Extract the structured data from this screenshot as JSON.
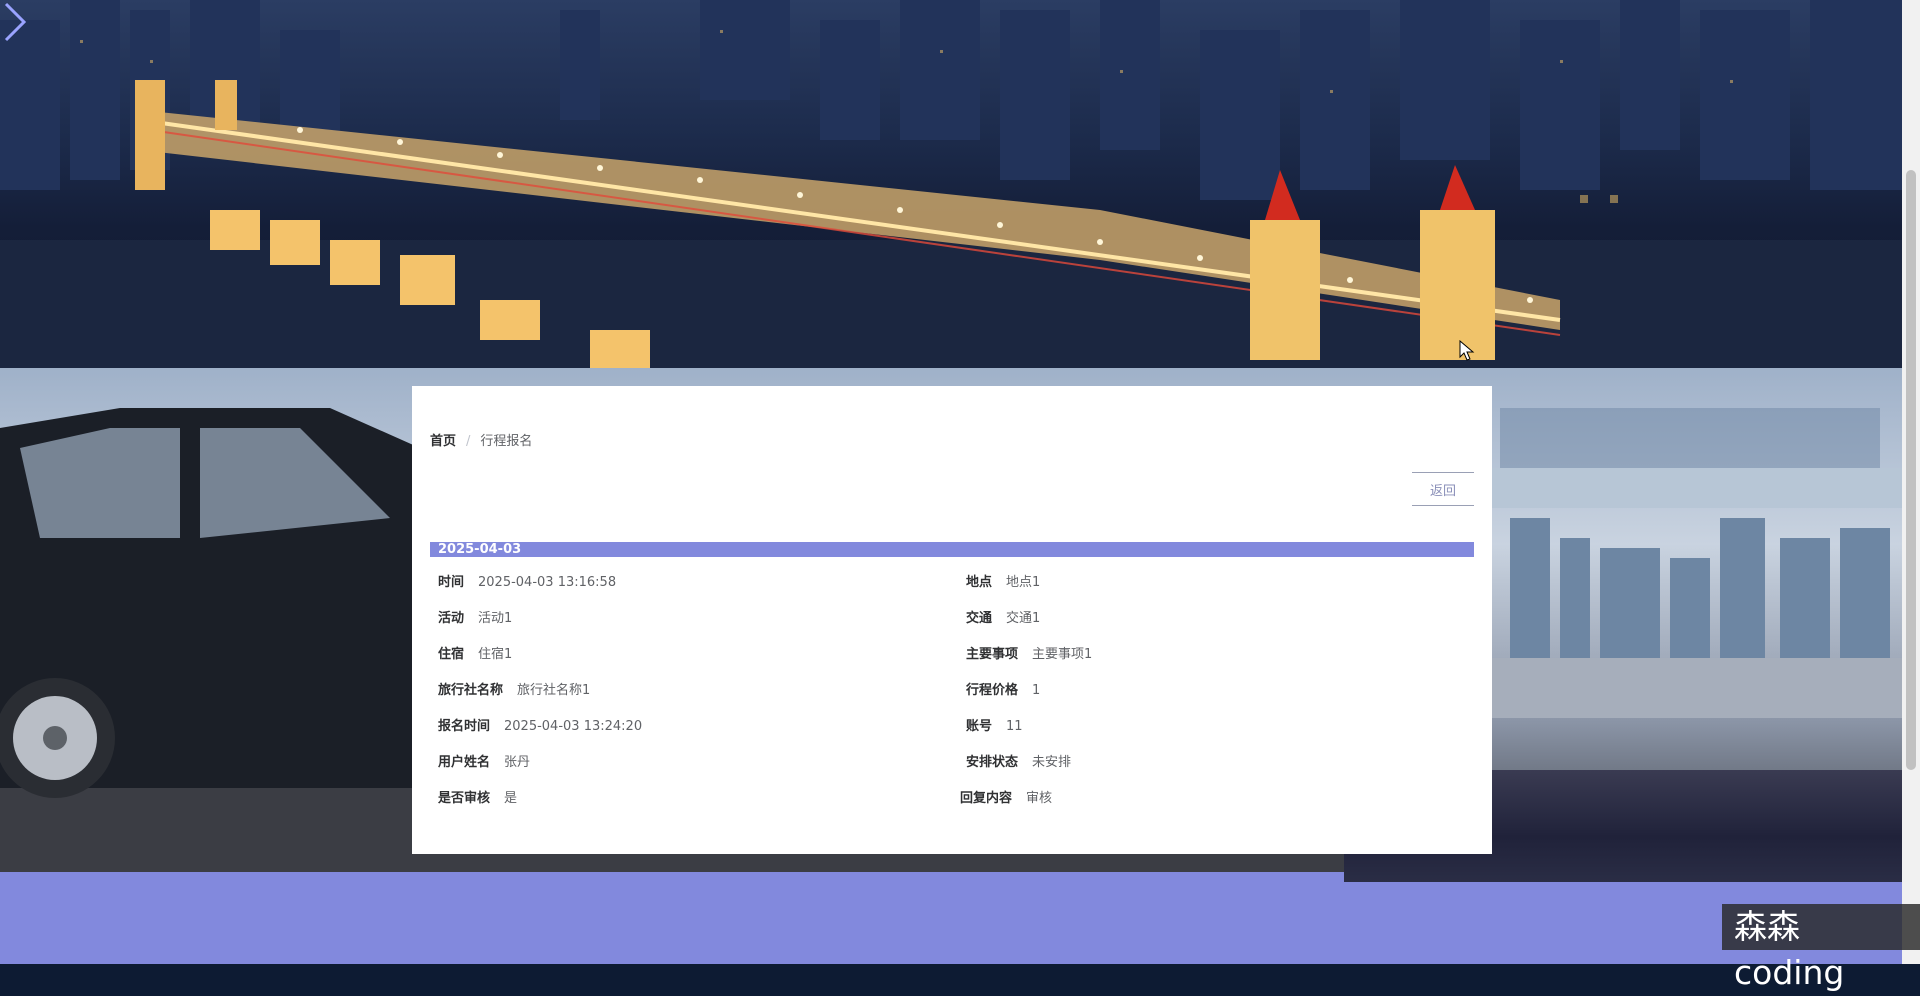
{
  "breadcrumb": {
    "home": "首页",
    "current": "行程报名"
  },
  "actions": {
    "back_label": "返回"
  },
  "record": {
    "date_header": "2025-04-03",
    "left": [
      {
        "label": "时间",
        "value": "2025-04-03 13:16:58"
      },
      {
        "label": "活动",
        "value": "活动1"
      },
      {
        "label": "住宿",
        "value": "住宿1"
      },
      {
        "label": "旅行社名称",
        "value": "旅行社名称1"
      },
      {
        "label": "报名时间",
        "value": "2025-04-03 13:24:20"
      },
      {
        "label": "用户姓名",
        "value": "张丹"
      },
      {
        "label": "是否审核",
        "value": "是"
      }
    ],
    "right": [
      {
        "label": "地点",
        "value": "地点1"
      },
      {
        "label": "交通",
        "value": "交通1"
      },
      {
        "label": "主要事项",
        "value": "主要事项1"
      },
      {
        "label": "行程价格",
        "value": "1"
      },
      {
        "label": "账号",
        "value": "11"
      },
      {
        "label": "安排状态",
        "value": "未安排"
      },
      {
        "label": "回复内容",
        "value": "审核"
      }
    ]
  },
  "watermark": "森森coding",
  "icons": {
    "banner_next": "chevron-right-icon",
    "cursor": "mouse-pointer-icon"
  },
  "colors": {
    "accent": "#8289dd",
    "footer": "#8289dd",
    "card": "#ffffff"
  }
}
